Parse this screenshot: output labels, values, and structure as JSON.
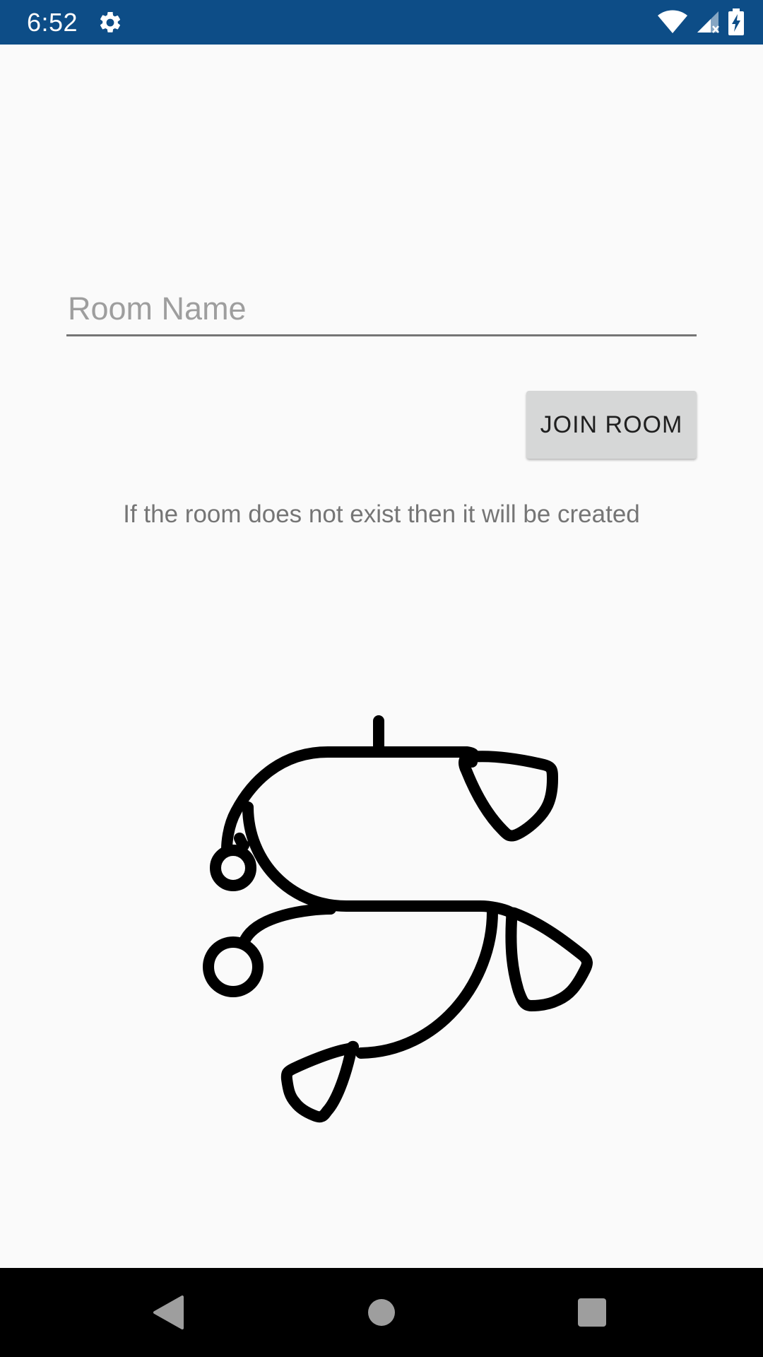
{
  "status_bar": {
    "time": "6:52",
    "background": "#0d4d87",
    "icons": [
      "settings-gear-icon",
      "wifi-icon",
      "cell-signal-icon",
      "battery-charging-icon"
    ]
  },
  "room_input": {
    "placeholder": "Room Name",
    "value": ""
  },
  "join_button": {
    "label": "JOIN ROOM"
  },
  "hint": {
    "text": "If the room does not exist then it will be created"
  },
  "logo": {
    "icon": "app-logo-icon"
  },
  "nav_bar": {
    "buttons": [
      "back-icon",
      "home-icon",
      "recents-icon"
    ]
  }
}
